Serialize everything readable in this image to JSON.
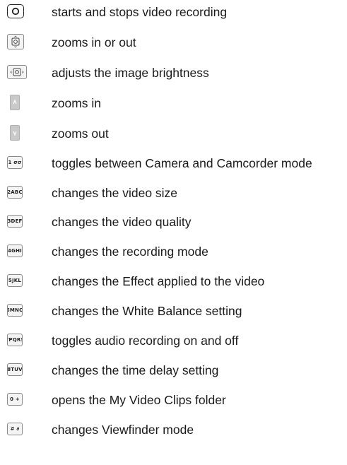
{
  "items": [
    {
      "icon": "record-button-icon",
      "label": "starts and stops video recording"
    },
    {
      "icon": "zoom-nav-icon",
      "label": "zooms in or out"
    },
    {
      "icon": "brightness-nav-icon",
      "label": "adjusts the image brightness"
    },
    {
      "icon": "volume-up-icon",
      "label": "zooms in"
    },
    {
      "icon": "volume-down-icon",
      "label": "zooms out"
    },
    {
      "icon": "key-1-icon",
      "key": "1 σσ",
      "label": "toggles between Camera and Camcorder mode"
    },
    {
      "icon": "key-2-icon",
      "key": "2ABC",
      "label": "changes the video size"
    },
    {
      "icon": "key-3-icon",
      "key": "3DEF",
      "label": "changes the video quality"
    },
    {
      "icon": "key-4-icon",
      "key": "4GHI",
      "label": "changes the recording mode"
    },
    {
      "icon": "key-5-icon",
      "key": "5JKL",
      "label": "changes the Effect applied to the video"
    },
    {
      "icon": "key-6-icon",
      "key": "6MNO",
      "label": "changes the White Balance setting"
    },
    {
      "icon": "key-7-icon",
      "key": "7PQRS",
      "label": "toggles audio recording on and off"
    },
    {
      "icon": "key-8-icon",
      "key": "8TUV",
      "label": "changes the time delay setting"
    },
    {
      "icon": "key-0-icon",
      "key": "0 +",
      "label": "opens the My Video Clips folder"
    },
    {
      "icon": "key-hash-icon",
      "key": "# ∂",
      "label": "changes Viewfinder mode"
    }
  ]
}
